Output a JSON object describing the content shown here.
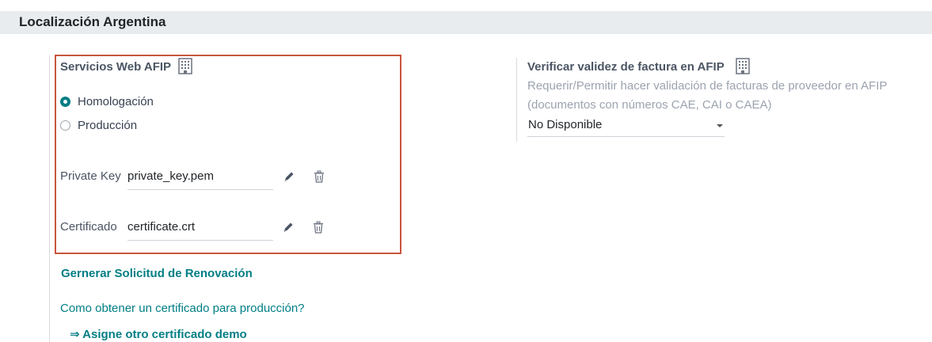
{
  "section": {
    "title": "Localización Argentina"
  },
  "afip_ws": {
    "title": "Servicios Web AFIP",
    "options": [
      {
        "label": "Homologación",
        "checked": true
      },
      {
        "label": "Producción",
        "checked": false
      }
    ],
    "private_key": {
      "label": "Private Key",
      "value": "private_key.pem"
    },
    "certificate": {
      "label": "Certificado",
      "value": "certificate.crt"
    }
  },
  "links": {
    "renewal": "Gernerar Solicitud de Renovación",
    "how_to": "Como obtener un certificado para producción?",
    "demo": "⇒ Asigne otro certificado demo"
  },
  "verify": {
    "title": "Verificar validez de factura en AFIP",
    "help_line1": "Requerir/Permitir hacer validación de facturas de proveedor en AFIP",
    "help_line2": "(documentos con números CAE, CAI o CAEA)",
    "selected": "No Disponible"
  },
  "icons": {
    "company": "building-icon",
    "edit": "pencil-icon",
    "delete": "trash-icon"
  },
  "colors": {
    "accent": "#017e84",
    "highlight_border": "#c8553d"
  }
}
